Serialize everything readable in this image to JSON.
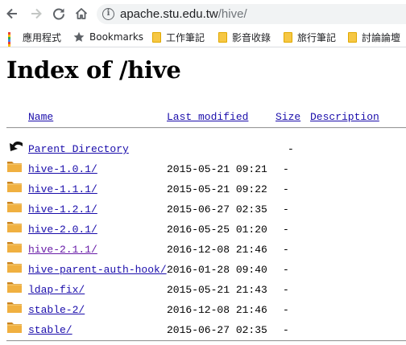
{
  "browser": {
    "url_host": "apache.stu.edu.tw",
    "url_path": "/hive/"
  },
  "bookmarks_bar": {
    "apps_label": "應用程式",
    "items": [
      "Bookmarks",
      "工作筆記",
      "影音收錄",
      "旅行筆記",
      "討論論壇"
    ]
  },
  "page": {
    "title": "Index of /hive",
    "columns": {
      "name": "Name",
      "last_modified": "Last modified",
      "size": "Size",
      "description": "Description"
    },
    "parent": {
      "name": "Parent Directory",
      "size": "-"
    },
    "entries": [
      {
        "name": "hive-1.0.1/",
        "modified": "2015-05-21 09:21",
        "size": "-",
        "visited": false
      },
      {
        "name": "hive-1.1.1/",
        "modified": "2015-05-21 09:22",
        "size": "-",
        "visited": false
      },
      {
        "name": "hive-1.2.1/",
        "modified": "2015-06-27 02:35",
        "size": "-",
        "visited": false
      },
      {
        "name": "hive-2.0.1/",
        "modified": "2016-05-25 01:20",
        "size": "-",
        "visited": false
      },
      {
        "name": "hive-2.1.1/",
        "modified": "2016-12-08 21:46",
        "size": "-",
        "visited": true
      },
      {
        "name": "hive-parent-auth-hook/",
        "modified": "2016-01-28 09:40",
        "size": "-",
        "visited": false
      },
      {
        "name": "ldap-fix/",
        "modified": "2015-05-21 21:43",
        "size": "-",
        "visited": false
      },
      {
        "name": "stable-2/",
        "modified": "2016-12-08 21:46",
        "size": "-",
        "visited": false
      },
      {
        "name": "stable/",
        "modified": "2015-06-27 02:35",
        "size": "-",
        "visited": false
      }
    ]
  },
  "icons": {
    "back": "arrow-left-icon",
    "forward": "arrow-right-icon",
    "reload": "reload-icon",
    "home": "home-icon",
    "info": "info-icon",
    "apps": "apps-grid-icon",
    "bookmark": "star-icon",
    "folder": "folder-icon",
    "parent": "back-arrow-icon"
  },
  "colors": {
    "link": "#1a0dab",
    "visited_link": "#681da8",
    "folder": "#f0b040",
    "bookmark_folder": "#f6c744"
  }
}
